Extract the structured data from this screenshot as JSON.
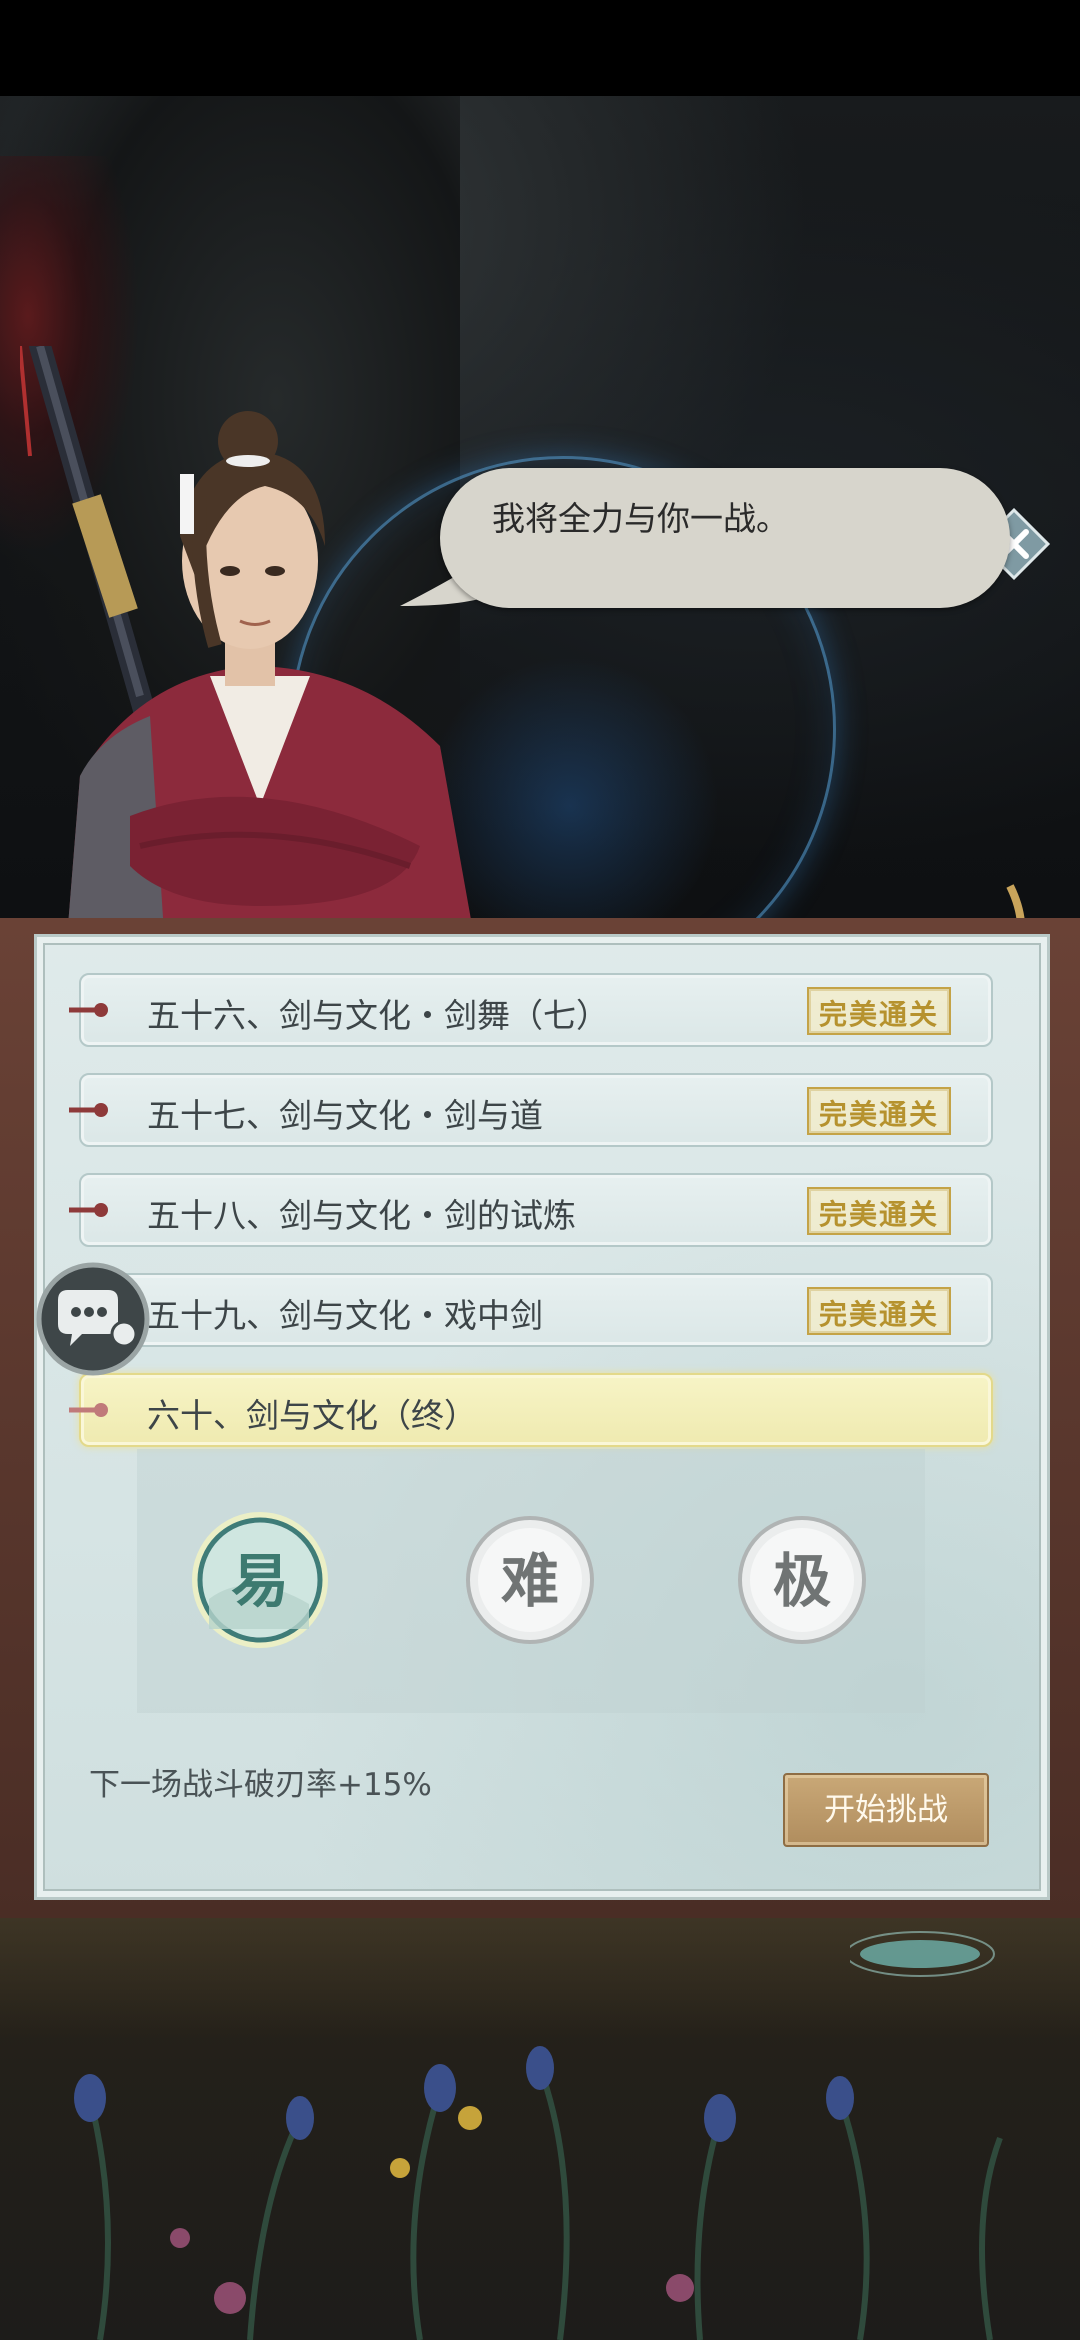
{
  "dialogue": {
    "line": "我将全力与你一战。"
  },
  "levels": [
    {
      "title": "五十六、剑与文化・剑舞（七）",
      "status": "完美通关"
    },
    {
      "title": "五十七、剑与文化・剑与道",
      "status": "完美通关"
    },
    {
      "title": "五十八、剑与文化・剑的试炼",
      "status": "完美通关"
    },
    {
      "title": "五十九、剑与文化・戏中剑",
      "status": "完美通关"
    },
    {
      "title": "六十、剑与文化（终）",
      "status": ""
    }
  ],
  "difficulty": {
    "options": [
      "易",
      "难",
      "极"
    ],
    "selected": "易"
  },
  "bonus_text": "下一场战斗破刃率+15%",
  "start_button": "开始挑战",
  "colors": {
    "panel_bg": "#d6e4e4",
    "active_row": "#f7f4c6",
    "stamp_gold": "#b6922e",
    "start_button": "#bf9d6c"
  },
  "icons": {
    "skip": "close-diamond-icon",
    "chat": "chat-bubble-icon",
    "lamp": "candle-lamp-icon"
  }
}
